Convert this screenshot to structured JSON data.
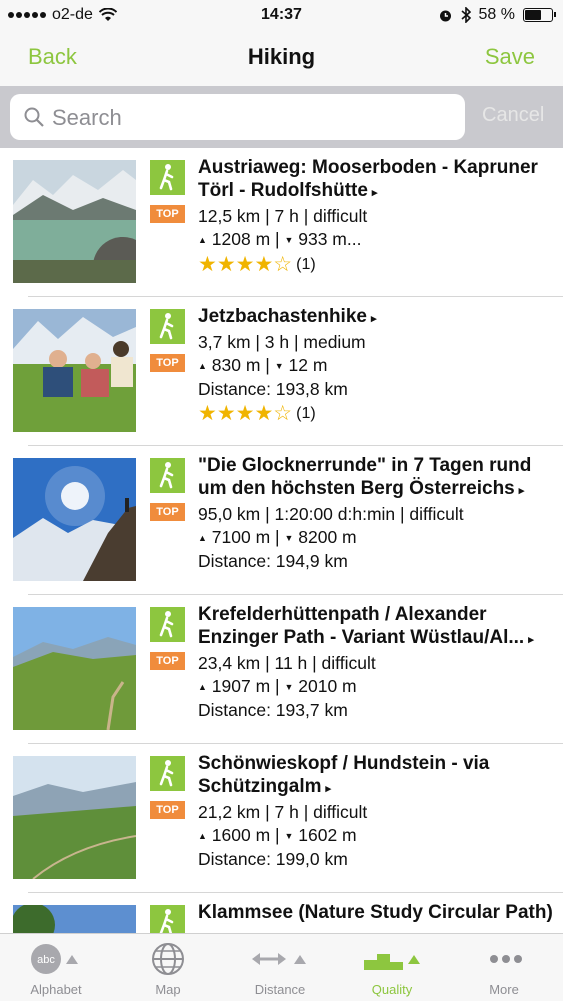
{
  "status_bar": {
    "carrier": "o2-de",
    "time": "14:37",
    "battery": "58 %"
  },
  "nav": {
    "back": "Back",
    "title": "Hiking",
    "save": "Save"
  },
  "search": {
    "placeholder": "Search",
    "cancel": "Cancel"
  },
  "colors": {
    "accent": "#8dc63f",
    "top_badge": "#f08c3c",
    "star": "#f0b400"
  },
  "items": [
    {
      "name": "Austriaweg: Mooserboden - Kapruner Törl - Rudolfshütte",
      "arrow": "▸",
      "top": "TOP",
      "stats": "12,5 km | 7 h | difficult",
      "up": "1208 m",
      "down": "933 m...",
      "distance": "",
      "rating_stars": "★★★★☆",
      "rating_count": "(1)"
    },
    {
      "name": "Jetzbachastenhike",
      "arrow": "▸",
      "top": "TOP",
      "stats": "3,7 km | 3 h | medium",
      "up": "830 m",
      "down": "12 m",
      "distance": "Distance: 193,8 km",
      "rating_stars": "★★★★☆",
      "rating_count": "(1)"
    },
    {
      "name": "\"Die Glocknerrunde\" in 7 Tagen rund um den höchsten Berg Österreichs",
      "arrow": "▸",
      "top": "TOP",
      "stats": "95,0 km | 1:20:00 d:h:min | difficult",
      "up": "7100 m",
      "down": "8200 m",
      "distance": "Distance: 194,9 km",
      "rating_stars": "",
      "rating_count": ""
    },
    {
      "name": "Krefelderhüttenpath / Alexander Enzinger Path - Variant Wüstlau/Al...",
      "arrow": "▸",
      "top": "TOP",
      "stats": "23,4 km | 11 h | difficult",
      "up": "1907 m",
      "down": "2010 m",
      "distance": "Distance: 193,7 km",
      "rating_stars": "",
      "rating_count": ""
    },
    {
      "name": "Schönwieskopf / Hundstein - via Schützingalm",
      "arrow": "▸",
      "top": "TOP",
      "stats": "21,2 km | 7 h | difficult",
      "up": "1600 m",
      "down": "1602 m",
      "distance": "Distance: 199,0 km",
      "rating_stars": "",
      "rating_count": ""
    },
    {
      "name": "Klammsee (Nature Study Circular Path)",
      "arrow": "",
      "top": "",
      "stats": "",
      "up": "",
      "down": "",
      "distance": "",
      "rating_stars": "",
      "rating_count": ""
    }
  ],
  "tabs": [
    {
      "label": "Alphabet",
      "icon": "abc-sort-icon",
      "glyph": "abc"
    },
    {
      "label": "Map",
      "icon": "globe-icon",
      "glyph": ""
    },
    {
      "label": "Distance",
      "icon": "distance-arrows-icon",
      "glyph": ""
    },
    {
      "label": "Quality",
      "icon": "podium-icon",
      "glyph": ""
    },
    {
      "label": "More",
      "icon": "more-dots-icon",
      "glyph": ""
    }
  ]
}
